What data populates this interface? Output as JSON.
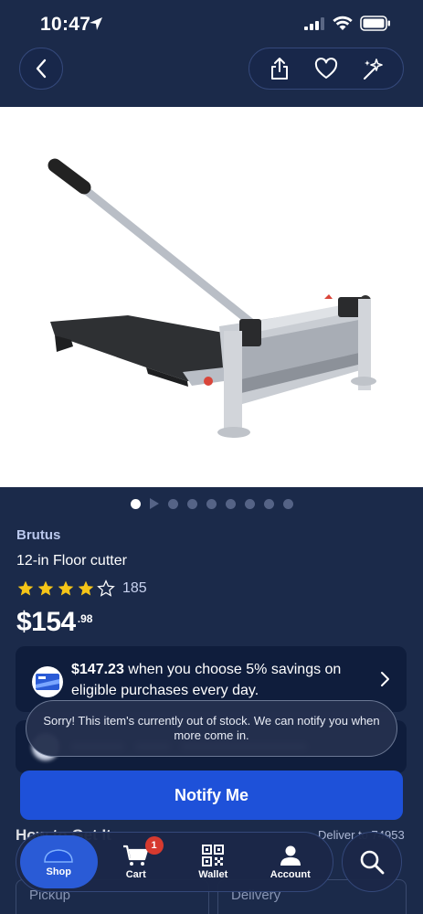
{
  "status_bar": {
    "time": "10:47"
  },
  "product": {
    "brand": "Brutus",
    "title": "12-in Floor cutter",
    "rating_stars": 4,
    "rating_max": 5,
    "review_count": "185",
    "price_main": "$154",
    "price_cents": ".98",
    "image_count": 9,
    "active_image": 1
  },
  "savings": {
    "price": "$147.23",
    "text": " when you choose 5% savings on eligible purchases every day."
  },
  "toast": {
    "message": "Sorry! This item's currently out of stock. We can notify you when more come in."
  },
  "notify_button": {
    "label": "Notify Me"
  },
  "fulfillment": {
    "heading": "How to Get It",
    "deliver_to": "Deliver to 74953",
    "pickup_label": "Pickup",
    "delivery_label": "Delivery"
  },
  "tabs": [
    {
      "label": "Shop",
      "icon": "shop-icon",
      "active": true
    },
    {
      "label": "Cart",
      "icon": "cart-icon",
      "badge": "1"
    },
    {
      "label": "Wallet",
      "icon": "qr-code-icon"
    },
    {
      "label": "Account",
      "icon": "person-icon"
    }
  ],
  "colors": {
    "background": "#1b2a4a",
    "card": "#0f1d3c",
    "accent": "#1e51d9",
    "star": "#f5c518",
    "badge": "#d63a2f"
  }
}
